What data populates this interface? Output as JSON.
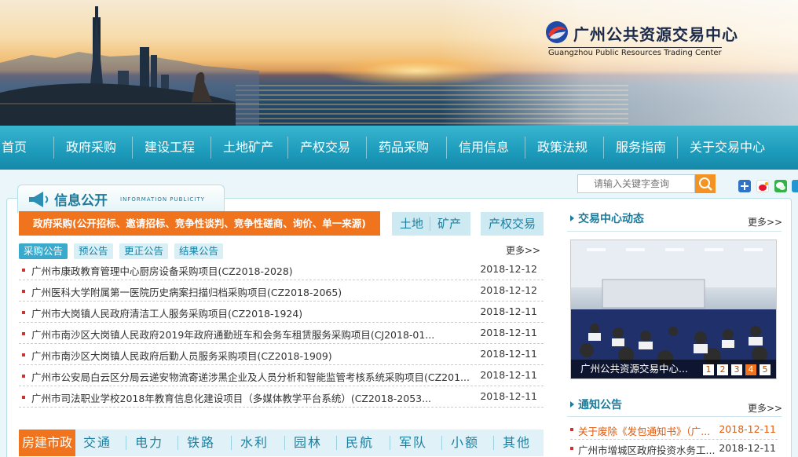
{
  "brand": {
    "name_cn": "广州公共资源交易中心",
    "name_en": "Guangzhou Public Resources Trading Center"
  },
  "colors": {
    "nav": "#1d9bbb",
    "accent_orange": "#f0731e",
    "link_blue": "#1e7fa0"
  },
  "nav": [
    "首页",
    "政府采购",
    "建设工程",
    "土地矿产",
    "产权交易",
    "药品采购",
    "信用信息",
    "政策法规",
    "服务指南",
    "关于交易中心"
  ],
  "search": {
    "placeholder": "请输入关键字查询",
    "icon": "search-icon"
  },
  "share_icons": [
    "plus-icon",
    "weibo-icon",
    "wechat-icon",
    "qq-icon"
  ],
  "section": {
    "title": "信息公开",
    "subtitle": "INFORMATION PUBLICITY"
  },
  "procurement": {
    "banner": "政府采购(公开招标、邀请招标、竞争性谈判、竞争性磋商、询价、单一来源)",
    "land_tabs": [
      "土地",
      "矿产"
    ],
    "property_tab": "产权交易",
    "subtabs": [
      "采购公告",
      "预公告",
      "更正公告",
      "结果公告"
    ],
    "more": "更多>>",
    "items": [
      {
        "title": "广州市康政教育管理中心厨房设备采购项目(CZ2018-2028)",
        "date": "2018-12-12"
      },
      {
        "title": "广州医科大学附属第一医院历史病案扫描归档采购项目(CZ2018-2065)",
        "date": "2018-12-12"
      },
      {
        "title": "广州市大岗镇人民政府清洁工人服务采购项目(CZ2018-1924)",
        "date": "2018-12-11"
      },
      {
        "title": "广州市南沙区大岗镇人民政府2019年政府通勤班车和会务车租赁服务采购项目(CJ2018-01...",
        "date": "2018-12-11"
      },
      {
        "title": "广州市南沙区大岗镇人民政府后勤人员服务采购项目(CZ2018-1909)",
        "date": "2018-12-11"
      },
      {
        "title": "广州市公安局白云区分局云递安物流寄递涉黑企业及人员分析和智能监管考核系统采购项目(CZ201...",
        "date": "2018-12-11"
      },
      {
        "title": "广州市司法职业学校2018年教育信息化建设项目（多媒体教学平台系统）(CZ2018-2053...",
        "date": "2018-12-11"
      }
    ]
  },
  "categories": [
    "房建市政",
    "交通",
    "电力",
    "铁路",
    "水利",
    "园林",
    "民航",
    "军队",
    "小额",
    "其他"
  ],
  "dynamics": {
    "title": "交易中心动态",
    "more": "更多>>",
    "caption": "广州公共资源交易中心...",
    "pages": [
      "1",
      "2",
      "3",
      "4",
      "5"
    ],
    "active_page": 4
  },
  "notices": {
    "title": "通知公告",
    "more": "更多>>",
    "items": [
      {
        "title": "关于废除《发包通知书》（广...",
        "date": "2018-12-11"
      },
      {
        "title": "广州市增城区政府投资水务工...",
        "date": "2018-12-11"
      }
    ]
  }
}
